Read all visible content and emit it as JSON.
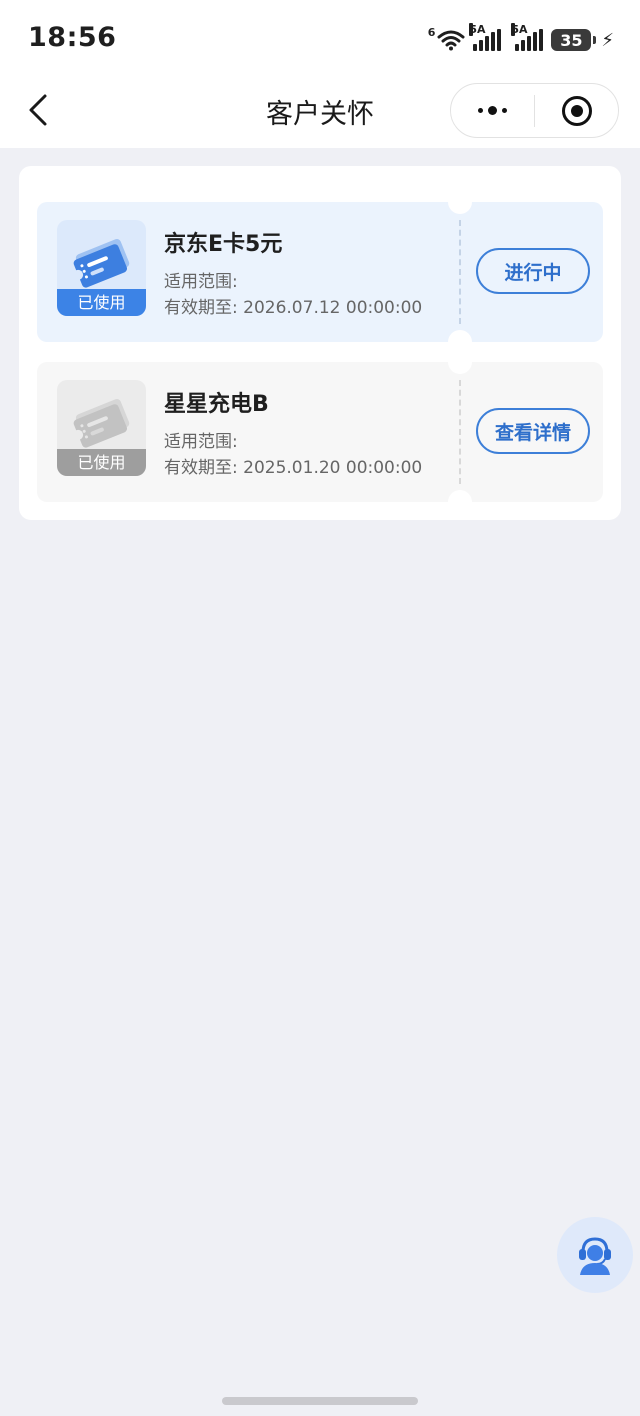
{
  "status_bar": {
    "time": "18:56",
    "wifi_label": "6",
    "signal1_label": "5A",
    "signal2_label": "5A",
    "battery": "35"
  },
  "nav": {
    "title": "客户关怀",
    "back_icon": "chevron-left-icon",
    "more_icon": "more-dots-icon",
    "close_icon": "target-circle-icon"
  },
  "coupons": [
    {
      "title": "京东E卡5元",
      "scope_label": "适用范围:",
      "expiry_label": "有效期至:",
      "expiry_value": "2026.07.12 00:00:00",
      "badge": "已使用",
      "action": "进行中",
      "state": "active"
    },
    {
      "title": "星星充电B",
      "scope_label": "适用范围:",
      "expiry_label": "有效期至:",
      "expiry_value": "2025.01.20 00:00:00",
      "badge": "已使用",
      "action": "查看详情",
      "state": "inactive"
    }
  ],
  "colors": {
    "accent": "#3c83e6",
    "button_text": "#2e6fcb",
    "background": "#eff0f5"
  },
  "floating": {
    "icon": "customer-service-icon"
  }
}
